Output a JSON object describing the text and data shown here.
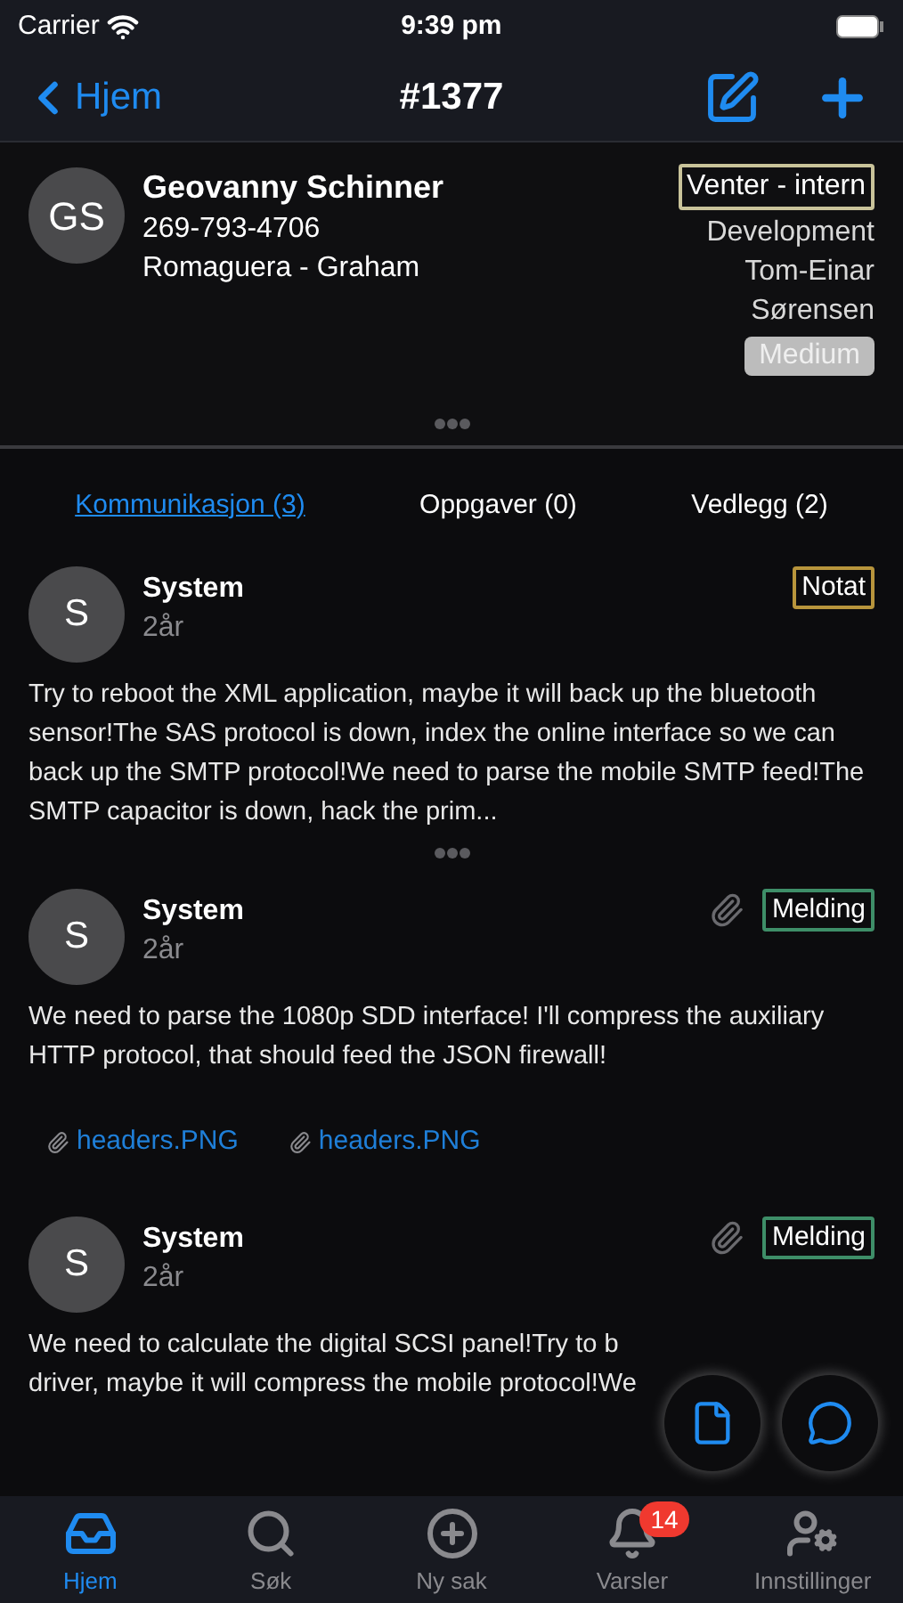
{
  "status_bar": {
    "carrier": "Carrier",
    "time": "9:39 pm"
  },
  "nav": {
    "back": "Hjem",
    "title": "#1377"
  },
  "contact": {
    "initials": "GS",
    "name": "Geovanny Schinner",
    "phone": "269-793-4706",
    "company": "Romaguera - Graham",
    "status": {
      "label": "Venter - intern",
      "color": "#c9c39a"
    },
    "department": "Development",
    "assignee": "Tom-Einar Sørensen",
    "priority": "Medium"
  },
  "tabs": [
    {
      "label": "Kommunikasjon (3)",
      "selected": true
    },
    {
      "label": "Oppgaver (0)",
      "selected": false
    },
    {
      "label": "Vedlegg (2)",
      "selected": false
    }
  ],
  "messages": [
    {
      "initials": "S",
      "author": "System",
      "age": "2år",
      "tag": {
        "label": "Notat",
        "color": "#b8953c"
      },
      "attachment": false,
      "collapsed": true,
      "body": "Try to reboot the XML application, maybe it will back up the bluetooth sensor!The SAS protocol is down, index the online interface so we can back up the SMTP protocol!We need to parse the mobile SMTP feed!The SMTP capacitor is down, hack the prim..."
    },
    {
      "initials": "S",
      "author": "System",
      "age": "2år",
      "tag": {
        "label": "Melding",
        "color": "#3e8e68"
      },
      "attachment": true,
      "collapsed": false,
      "body": "We need to parse the 1080p SDD interface! I'll compress the auxiliary HTTP protocol, that should feed the JSON firewall!",
      "files": [
        "headers.PNG",
        "headers.PNG"
      ]
    },
    {
      "initials": "S",
      "author": "System",
      "age": "2år",
      "tag": {
        "label": "Melding",
        "color": "#3e8e68"
      },
      "attachment": true,
      "collapsed": false,
      "lines": [
        "We need to calculate the digital SCSI panel!Try to b",
        "driver, maybe it will compress the mobile protocol!We"
      ]
    }
  ],
  "tab_bar": [
    {
      "kind": "inbox",
      "label": "Hjem",
      "selected": true
    },
    {
      "kind": "search",
      "label": "Søk",
      "selected": false
    },
    {
      "kind": "new",
      "label": "Ny sak",
      "selected": false
    },
    {
      "kind": "bell",
      "label": "Varsler",
      "selected": false,
      "badge": "14"
    },
    {
      "kind": "user-settings",
      "label": "Innstillinger",
      "selected": false
    }
  ]
}
